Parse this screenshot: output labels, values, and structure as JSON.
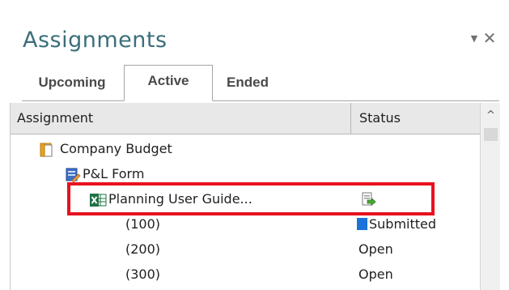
{
  "pane": {
    "title": "Assignments",
    "dropdown_glyph": "▼",
    "close_glyph": "✕"
  },
  "tabs": [
    {
      "label": "Upcoming",
      "selected": false
    },
    {
      "label": "Active",
      "selected": true
    },
    {
      "label": "Ended",
      "selected": false
    }
  ],
  "grid": {
    "columns": [
      "Assignment",
      "Status"
    ],
    "scroll_up_glyph": "^",
    "rows": [
      {
        "name": "Company Budget",
        "icon": "folder-icon",
        "status": "",
        "status_icon": ""
      },
      {
        "name": "P&L Form",
        "icon": "form-icon",
        "status": "",
        "status_icon": ""
      },
      {
        "name": "Planning User Guide...",
        "icon": "excel-icon",
        "status": "",
        "status_icon": "open-document-icon"
      },
      {
        "name": "(100)",
        "icon": "",
        "status": "Submitted",
        "status_icon": "submitted-status-icon"
      },
      {
        "name": "(200)",
        "icon": "",
        "status": "Open",
        "status_icon": ""
      },
      {
        "name": "(300)",
        "icon": "",
        "status": "Open",
        "status_icon": ""
      }
    ]
  },
  "colors": {
    "title": "#3a6e7a",
    "highlight_border": "#e8121f",
    "submitted_status": "#1a73d9",
    "excel_green": "#1f7244"
  }
}
